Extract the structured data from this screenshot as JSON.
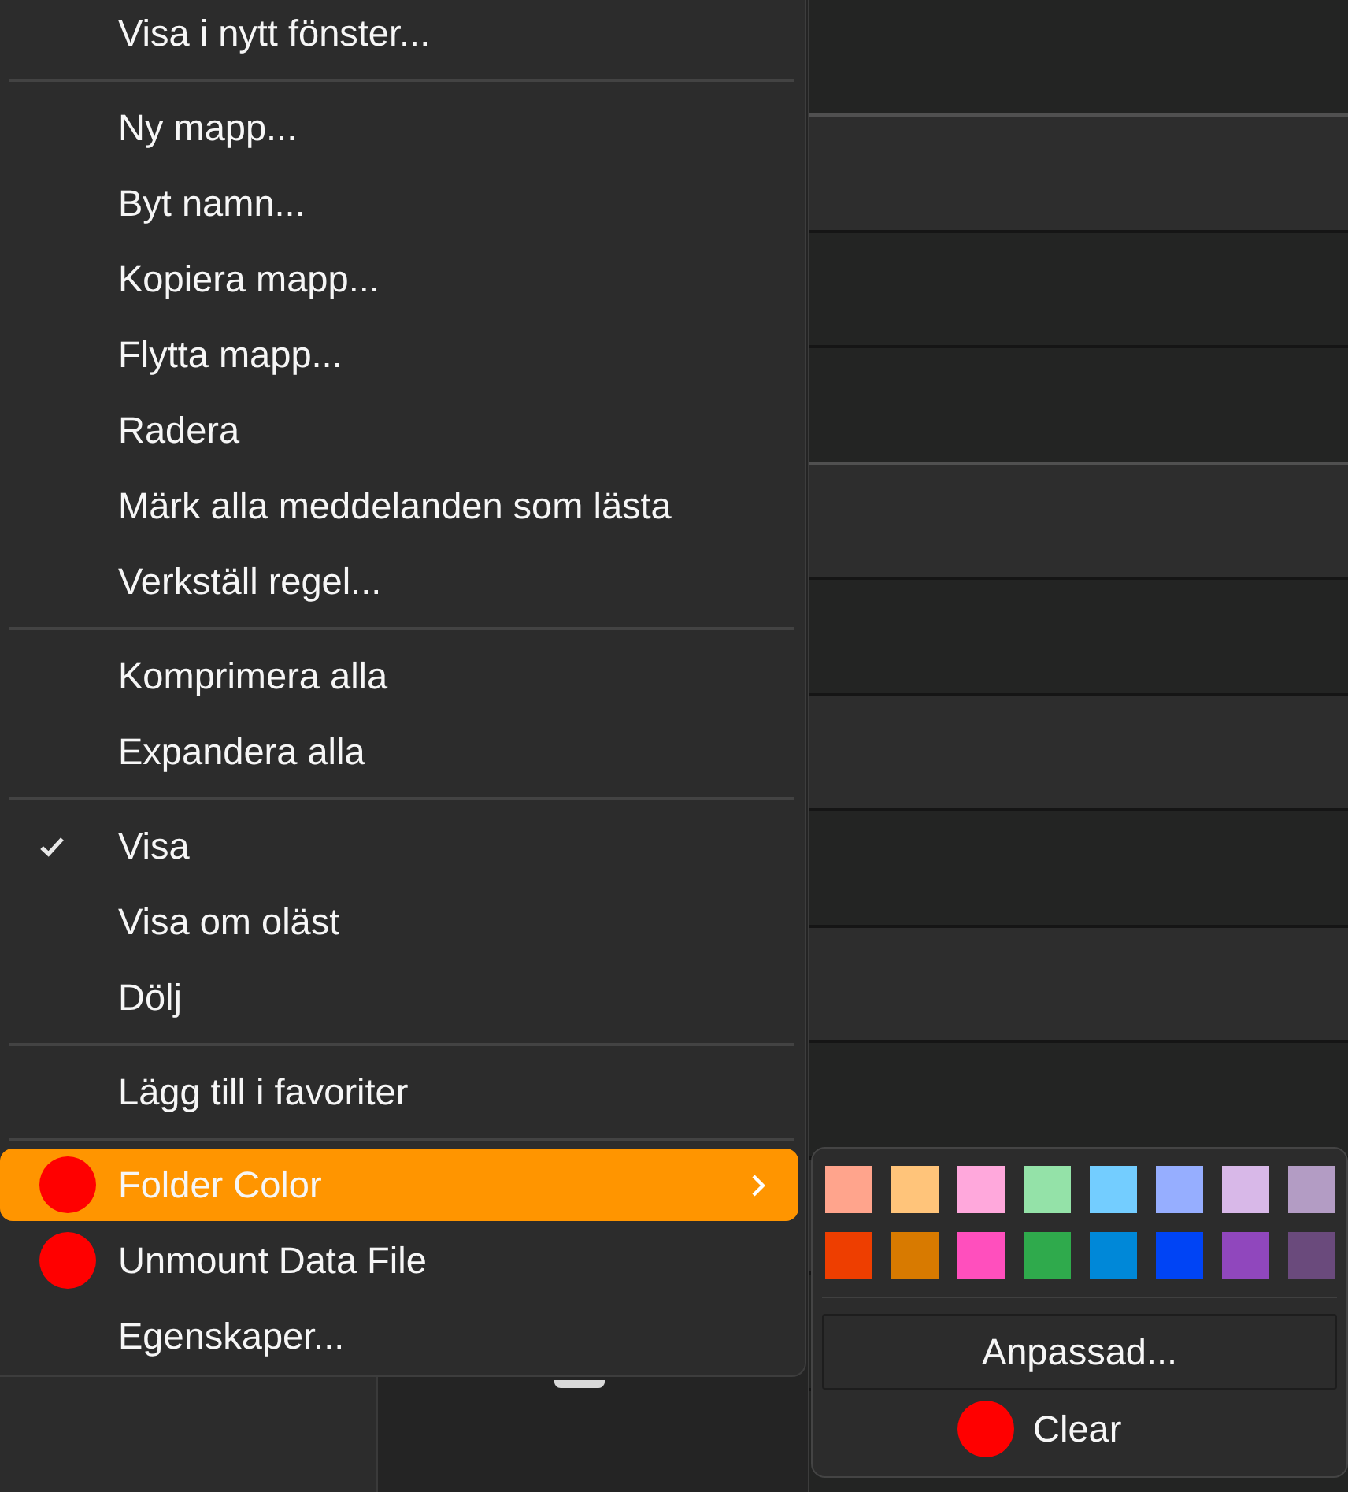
{
  "context_menu": {
    "items": [
      {
        "kind": "item",
        "label": "Visa i nytt fönster...",
        "checked": false,
        "selected": false
      },
      {
        "kind": "separator"
      },
      {
        "kind": "item",
        "label": "Ny mapp...",
        "checked": false,
        "selected": false
      },
      {
        "kind": "item",
        "label": "Byt namn...",
        "checked": false,
        "selected": false
      },
      {
        "kind": "item",
        "label": "Kopiera mapp...",
        "checked": false,
        "selected": false
      },
      {
        "kind": "item",
        "label": "Flytta mapp...",
        "checked": false,
        "selected": false
      },
      {
        "kind": "item",
        "label": "Radera",
        "checked": false,
        "selected": false
      },
      {
        "kind": "item",
        "label": "Märk alla meddelanden som lästa",
        "checked": false,
        "selected": false
      },
      {
        "kind": "item",
        "label": "Verkställ regel...",
        "checked": false,
        "selected": false
      },
      {
        "kind": "separator"
      },
      {
        "kind": "item",
        "label": "Komprimera alla",
        "checked": false,
        "selected": false
      },
      {
        "kind": "item",
        "label": "Expandera alla",
        "checked": false,
        "selected": false
      },
      {
        "kind": "separator"
      },
      {
        "kind": "item",
        "label": "Visa",
        "checked": true,
        "selected": false
      },
      {
        "kind": "item",
        "label": "Visa om oläst",
        "checked": false,
        "selected": false
      },
      {
        "kind": "item",
        "label": "Dölj",
        "checked": false,
        "selected": false
      },
      {
        "kind": "separator"
      },
      {
        "kind": "item",
        "label": "Lägg till i favoriter",
        "checked": false,
        "selected": false
      },
      {
        "kind": "separator"
      },
      {
        "kind": "item",
        "label": "Folder Color",
        "checked": false,
        "selected": true,
        "color": "#ff0000",
        "submenu": true
      },
      {
        "kind": "item",
        "label": "Unmount Data File",
        "checked": false,
        "selected": false,
        "color": "#ff0000"
      },
      {
        "kind": "item",
        "label": "Egenskaper...",
        "checked": false,
        "selected": false
      }
    ]
  },
  "color_submenu": {
    "swatches": [
      {
        "color": "#ffa48c",
        "selected": false
      },
      {
        "color": "#ffc47a",
        "selected": false
      },
      {
        "color": "#ffa8dc",
        "selected": false
      },
      {
        "color": "#94e2a8",
        "selected": false
      },
      {
        "color": "#73cdff",
        "selected": false
      },
      {
        "color": "#96aeff",
        "selected": false
      },
      {
        "color": "#d8b8e8",
        "selected": false
      },
      {
        "color": "#b39cc4",
        "selected": false
      },
      {
        "color": "#ee3e00",
        "selected": false
      },
      {
        "color": "#d87a00",
        "selected": false
      },
      {
        "color": "#ff4fbd",
        "selected": false
      },
      {
        "color": "#2faa4c",
        "selected": false
      },
      {
        "color": "#0088d8",
        "selected": false
      },
      {
        "color": "#0044f5",
        "selected": false
      },
      {
        "color": "#9047bd",
        "selected": false
      },
      {
        "color": "#6a4a7c",
        "selected": false
      }
    ],
    "custom_button": "Anpassad...",
    "clear": {
      "label": "Clear",
      "color": "#ff0000"
    }
  }
}
